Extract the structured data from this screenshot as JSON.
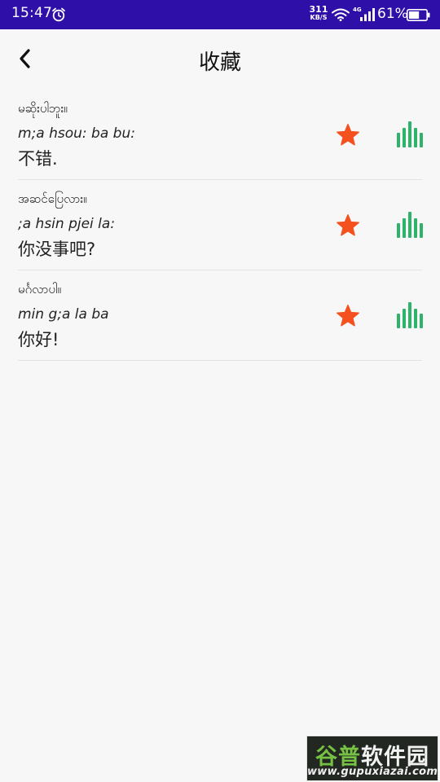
{
  "status_bar": {
    "time": "15:47",
    "net_speed_value": "311",
    "net_speed_unit": "KB/S",
    "network_type": "4G",
    "battery_percent": "61%",
    "battery_level": 0.61,
    "background_color": "#2e0fa8",
    "icons": [
      "alarm-icon",
      "wifi-icon",
      "signal-icon",
      "battery-icon"
    ]
  },
  "header": {
    "title": "收藏",
    "back_icon": "chevron-left-icon"
  },
  "favorites": [
    {
      "burmese": "မဆိုးပါဘူး။",
      "romanization": "m;a hsou: ba bu:",
      "chinese": "不错.",
      "favorited": true
    },
    {
      "burmese": "အဆင်ပြေလား။",
      "romanization": ";a hsin pjei la:",
      "chinese": "你没事吧?",
      "favorited": true
    },
    {
      "burmese": "မင်္ဂလာပါ။",
      "romanization": "min g;a la ba",
      "chinese": "你好!",
      "favorited": true
    }
  ],
  "colors": {
    "star": "#f4511e",
    "audio": "#2db36a",
    "background": "#f7f7f7"
  },
  "watermark": {
    "brand_part1": "谷普",
    "brand_part2": "软件园",
    "url": "www.gupuxiazai.com"
  }
}
